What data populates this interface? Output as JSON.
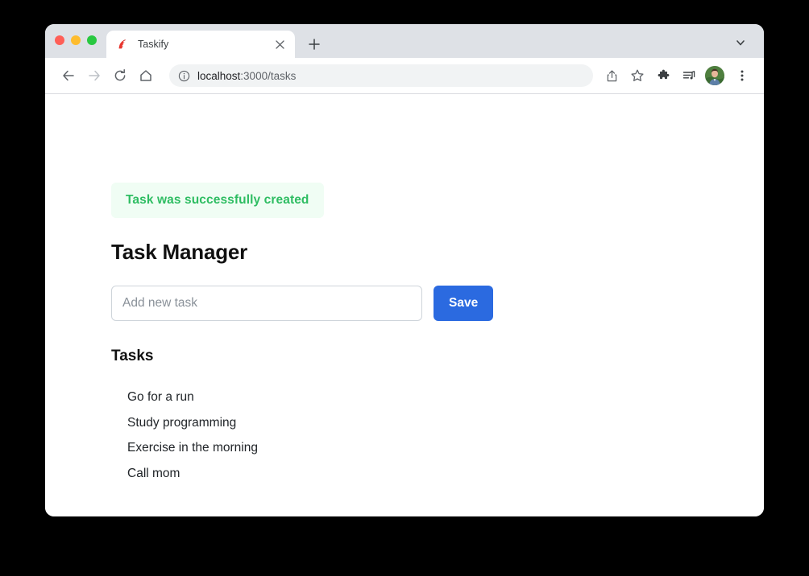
{
  "window": {
    "traffic_lights": [
      "close",
      "minimize",
      "maximize"
    ]
  },
  "tab_strip": {
    "tab": {
      "favicon": "rails-logo-icon",
      "title": "Taskify",
      "close_label": "×"
    },
    "new_tab_label": "+",
    "tab_list_chevron": "chevron-down-icon"
  },
  "toolbar": {
    "back": "back-arrow-icon",
    "forward": "forward-arrow-icon",
    "reload": "reload-icon",
    "home": "home-icon",
    "omnibox": {
      "site_info_icon": "info-circle-icon",
      "url_host": "localhost",
      "url_rest": ":3000/tasks",
      "full_url": "localhost:3000/tasks"
    },
    "share_icon": "share-icon",
    "bookmark_icon": "star-icon",
    "extensions_icon": "puzzle-icon",
    "media_icon": "playlist-music-icon",
    "avatar": "profile-avatar",
    "menu_icon": "three-dot-menu-icon"
  },
  "page": {
    "alert": {
      "message": "Task was successfully created",
      "text_color": "#2ebd62",
      "background_color": "#f0fdf4"
    },
    "title": "Task Manager",
    "form": {
      "input_value": "",
      "input_placeholder": "Add new task",
      "save_label": "Save",
      "save_color": "#2b6ae0"
    },
    "tasks_heading": "Tasks",
    "tasks": [
      "Go for a run",
      "Study programming",
      "Exercise in the morning",
      "Call mom"
    ]
  }
}
